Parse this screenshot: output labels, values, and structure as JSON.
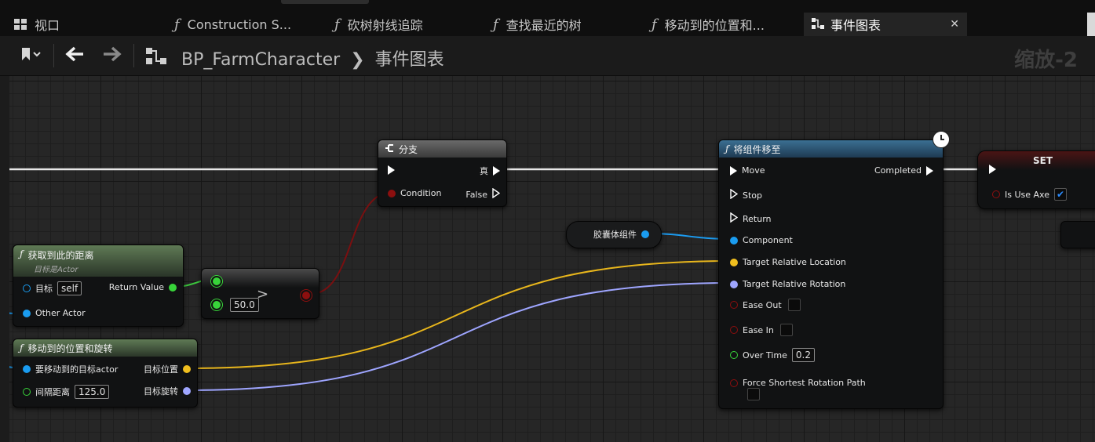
{
  "tabs": [
    {
      "label": "视口"
    },
    {
      "label": "Construction S..."
    },
    {
      "label": "砍树射线追踪"
    },
    {
      "label": "查找最近的树"
    },
    {
      "label": "移动到的位置和..."
    },
    {
      "label": "事件图表",
      "active": true
    }
  ],
  "breadcrumb": {
    "blueprint": "BP_FarmCharacter",
    "graph": "事件图表"
  },
  "zoom_label": "缩放-2",
  "nodes": {
    "branch": {
      "title": "分支",
      "true_label": "真",
      "condition_label": "Condition",
      "false_label": "False"
    },
    "move_component": {
      "title": "将组件移至",
      "pins": [
        "Move",
        "Stop",
        "Return",
        "Component",
        "Target Relative Location",
        "Target Relative Rotation",
        "Ease Out",
        "Ease In",
        "Over Time",
        "Force Shortest Rotation Path"
      ],
      "completed_label": "Completed",
      "over_time_value": "0.2"
    },
    "set": {
      "title": "SET",
      "var_label": "Is Use Axe",
      "checked": true
    },
    "capsule": {
      "label": "胶囊体组件"
    },
    "get_distance": {
      "title": "获取到此的距离",
      "subtitle": "目标是Actor",
      "target_label": "目标",
      "target_value": "self",
      "other_actor_label": "Other Actor",
      "return_label": "Return Value"
    },
    "greater": {
      "symbol": ">",
      "value": "50.0"
    },
    "move_pos_rot": {
      "title": "移动到的位置和旋转",
      "target_actor_label": "要移动到的目标actor",
      "gap_label": "间隔距离",
      "gap_value": "125.0",
      "out_location_label": "目标位置",
      "out_rotation_label": "目标旋转"
    }
  },
  "colors": {
    "exec": "#ffffff",
    "bool": "#8c0f0f",
    "float": "#38d43a",
    "object": "#1a9cf0",
    "vector": "#f0be1e",
    "rotator": "#9fa6ff"
  }
}
